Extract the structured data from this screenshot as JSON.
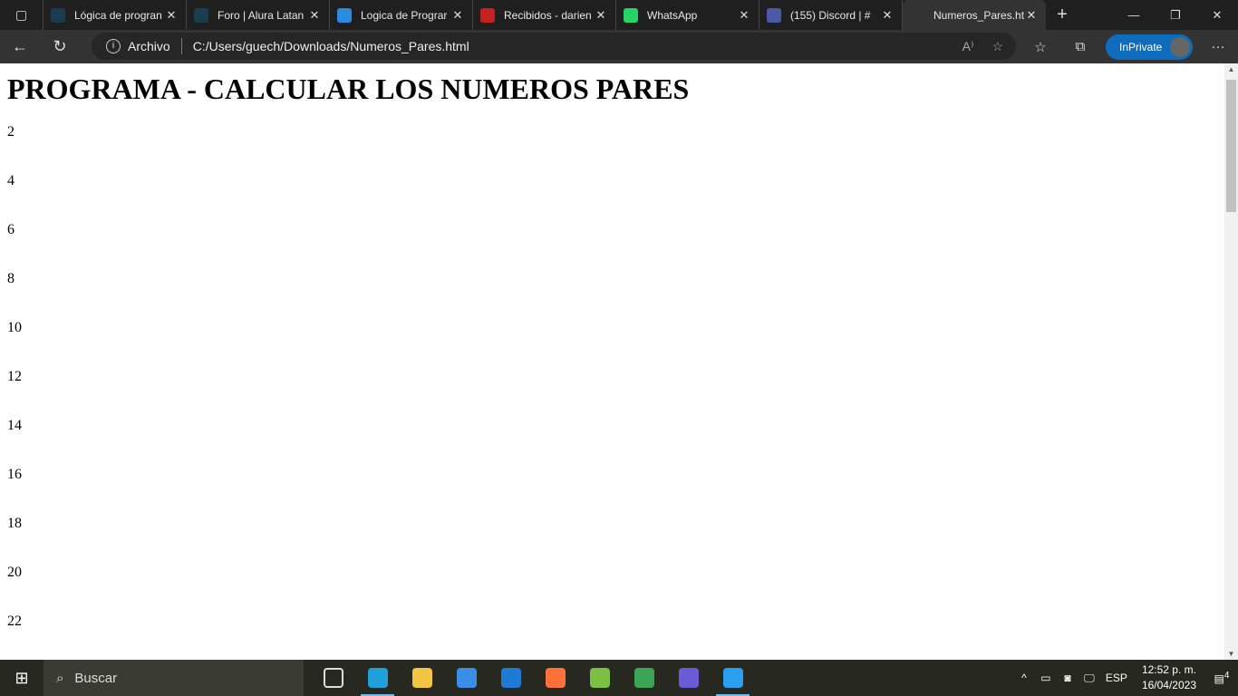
{
  "browser": {
    "tabs": [
      {
        "title": "Lógica de progran",
        "icon": "alura-icon",
        "color": "#1c3d4f"
      },
      {
        "title": "Foro | Alura Latan",
        "icon": "alura-icon",
        "color": "#1c3d4f"
      },
      {
        "title": "Logica de Prograr",
        "icon": "onedrive-icon",
        "color": "#2a8ce0"
      },
      {
        "title": "Recibidos - darien",
        "icon": "gmail-icon",
        "color": "#c5221f"
      },
      {
        "title": "WhatsApp",
        "icon": "whatsapp-icon",
        "color": "#25d366"
      },
      {
        "title": "(155) Discord | # ",
        "icon": "discord-icon",
        "color": "#4a5aa8"
      },
      {
        "title": "Numeros_Pares.ht",
        "icon": "file-icon",
        "color": "#333333",
        "active": true
      }
    ],
    "address": {
      "security_label": "Archivo",
      "url": "C:/Users/guech/Downloads/Numeros_Pares.html"
    },
    "inprivate_label": "InPrivate"
  },
  "page": {
    "heading": "PROGRAMA - CALCULAR LOS NUMEROS PARES",
    "numbers": [
      "2",
      "4",
      "6",
      "8",
      "10",
      "12",
      "14",
      "16",
      "18",
      "20",
      "22"
    ]
  },
  "taskbar": {
    "search_placeholder": "Buscar",
    "language": "ESP",
    "time": "12:52 p. m.",
    "date": "16/04/2023",
    "notification_count": "4",
    "apps": [
      {
        "name": "task-view-icon",
        "color": "#272920"
      },
      {
        "name": "edge-icon",
        "color": "#1fa0d8",
        "active": true
      },
      {
        "name": "file-explorer-icon",
        "color": "#f4c542"
      },
      {
        "name": "microsoft-store-icon",
        "color": "#3a8ee6"
      },
      {
        "name": "mail-icon",
        "color": "#1f7ad6"
      },
      {
        "name": "firefox-icon",
        "color": "#ff7139"
      },
      {
        "name": "cloud-app-icon",
        "color": "#7bc043"
      },
      {
        "name": "notes-app-icon",
        "color": "#3aa655"
      },
      {
        "name": "copilot-app-icon",
        "color": "#6a5cd8"
      },
      {
        "name": "vscode-icon",
        "color": "#2a9ff0",
        "active": true
      }
    ]
  }
}
